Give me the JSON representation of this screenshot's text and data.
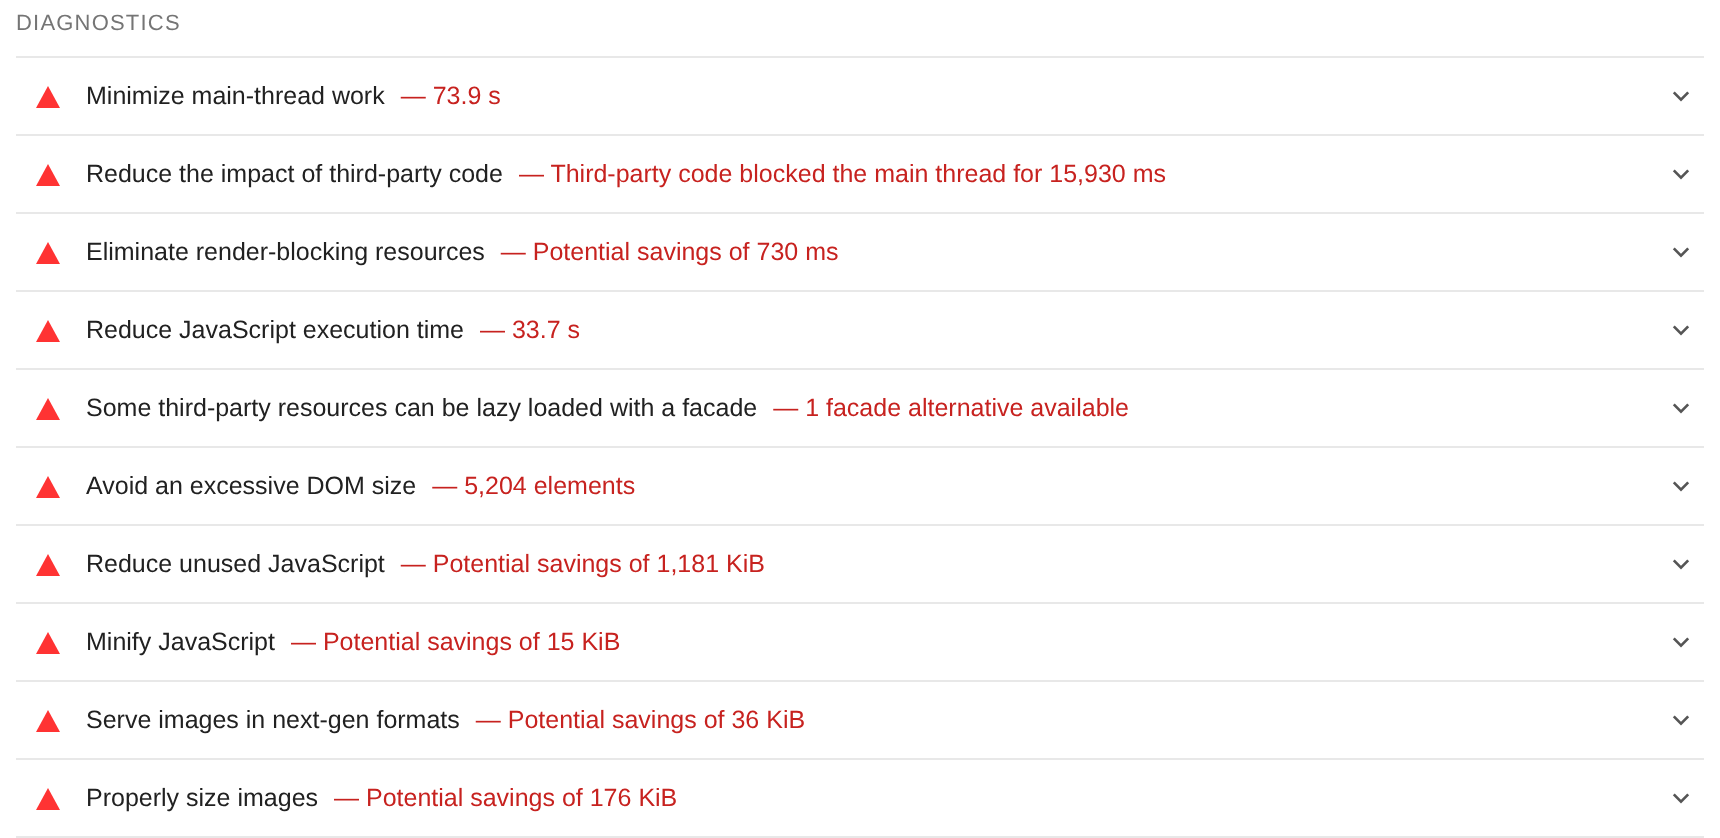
{
  "section_title": "DIAGNOSTICS",
  "audits": [
    {
      "kind": "fail",
      "title": "Minimize main-thread work",
      "display_value": "— 73.9 s",
      "expanded": false
    },
    {
      "kind": "fail",
      "title": "Reduce the impact of third-party code",
      "display_value": "— Third-party code blocked the main thread for 15,930 ms",
      "expanded": false
    },
    {
      "kind": "fail",
      "title": "Eliminate render-blocking resources",
      "display_value": "— Potential savings of 730 ms",
      "expanded": false
    },
    {
      "kind": "fail",
      "title": "Reduce JavaScript execution time",
      "display_value": "— 33.7 s",
      "expanded": false
    },
    {
      "kind": "fail",
      "title": "Some third-party resources can be lazy loaded with a facade",
      "display_value": "— 1 facade alternative available",
      "expanded": false
    },
    {
      "kind": "fail",
      "title": "Avoid an excessive DOM size",
      "display_value": "— 5,204 elements",
      "expanded": false
    },
    {
      "kind": "fail",
      "title": "Reduce unused JavaScript",
      "display_value": "— Potential savings of 1,181 KiB",
      "expanded": false
    },
    {
      "kind": "fail",
      "title": "Minify JavaScript",
      "display_value": "— Potential savings of 15 KiB",
      "expanded": false
    },
    {
      "kind": "fail",
      "title": "Serve images in next-gen formats",
      "display_value": "— Potential savings of 36 KiB",
      "expanded": false
    },
    {
      "kind": "fail",
      "title": "Properly size images",
      "display_value": "— Potential savings of 176 KiB",
      "expanded": false
    }
  ]
}
